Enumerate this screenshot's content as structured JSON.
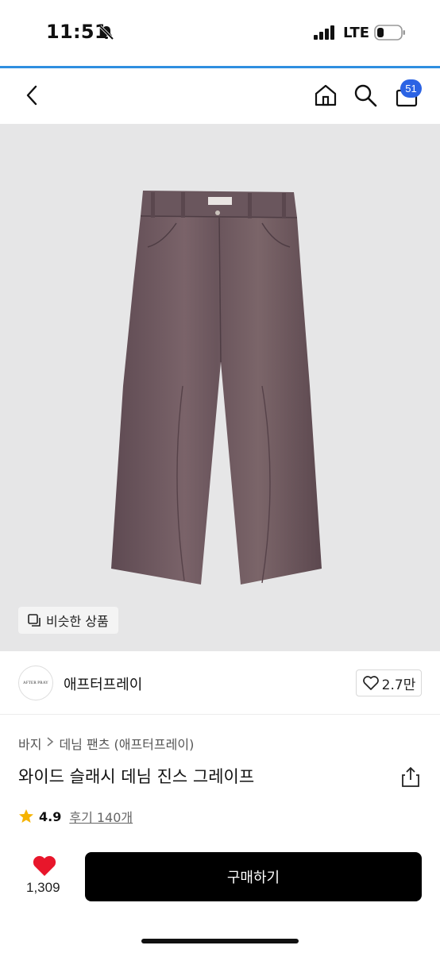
{
  "status_bar": {
    "time": "11:51",
    "network": "LTE"
  },
  "nav": {
    "cart_count": "51"
  },
  "product_image": {
    "similar_label": "비슷한 상품",
    "garment_color": "#6e5960"
  },
  "brand": {
    "logo_text": "AFTER PRAY",
    "name": "애프터프레이",
    "likes": "2.7만"
  },
  "breadcrumb": {
    "category": "바지",
    "subcategory": "데님 팬츠 (애프터프레이)"
  },
  "product": {
    "title": "와이드 슬래시 데님 진스 그레이프",
    "rating": "4.9",
    "reviews": "후기 140개"
  },
  "bottom_bar": {
    "wish_count": "1,309",
    "buy_label": "구매하기"
  },
  "colors": {
    "accent_blue": "#2b63e4",
    "progress_blue": "#2f8fe0",
    "heart_red": "#e8162b",
    "star_gold": "#f5b301"
  }
}
